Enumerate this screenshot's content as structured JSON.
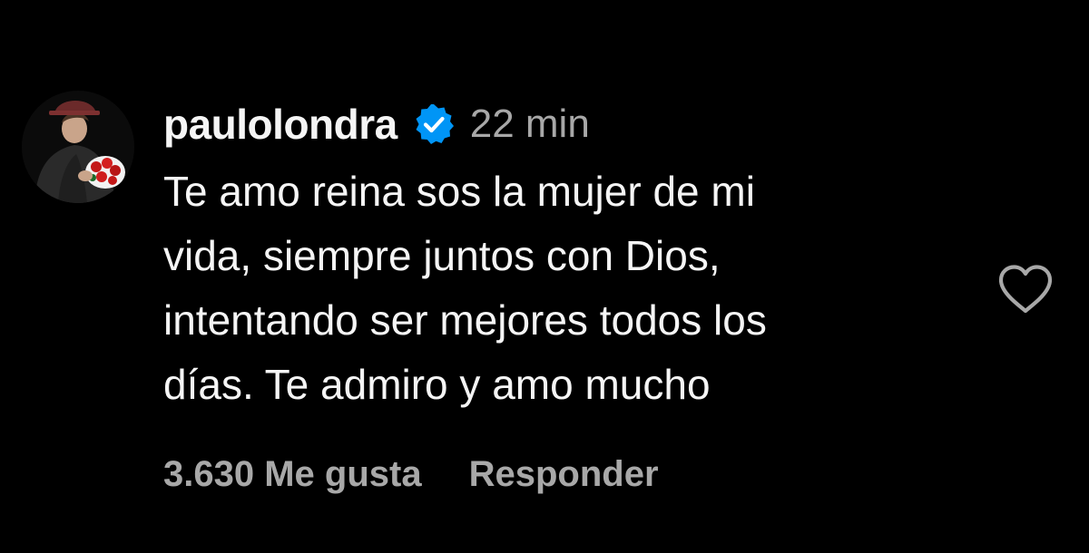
{
  "comment": {
    "username": "paulolondra",
    "verified": true,
    "timestamp": "22 min",
    "text": "Te amo reina sos la mujer de mi\nvida, siempre juntos con Dios,\nintentando ser mejores todos los\ndías. Te admiro y amo mucho",
    "likes_label": "3.630 Me gusta",
    "reply_label": "Responder"
  },
  "icons": {
    "verified": "verified-badge-icon",
    "like": "heart-outline-icon",
    "avatar": "profile-avatar"
  },
  "colors": {
    "background": "#000000",
    "primary_text": "#f5f5f5",
    "secondary_text": "#a8a8a8",
    "verified_blue": "#0095f6"
  }
}
